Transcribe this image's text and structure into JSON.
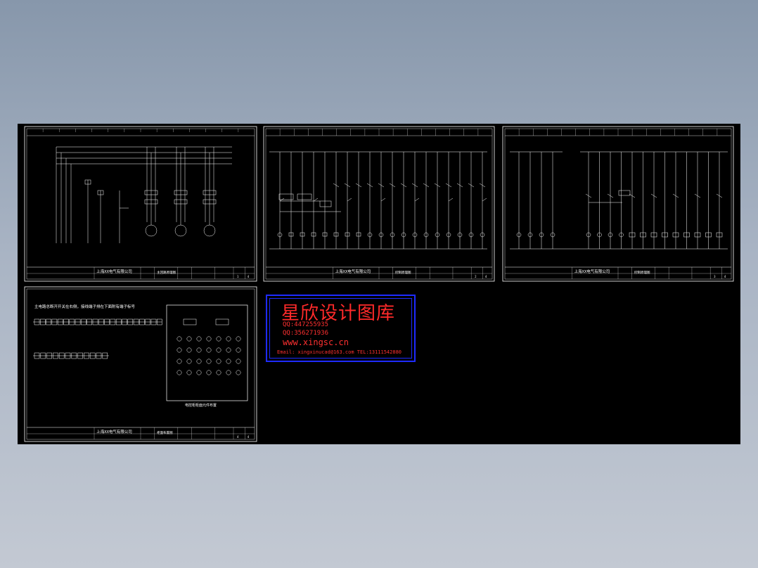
{
  "sheets": [
    {
      "company": "上海XX电气有限公司",
      "drawing": "主回路原理图",
      "sheet_no": "1",
      "total": "4"
    },
    {
      "company": "上海XX电气有限公司",
      "drawing": "控制原理图",
      "sheet_no": "2",
      "total": "4"
    },
    {
      "company": "上海XX电气有限公司",
      "drawing": "控制原理图",
      "sheet_no": "3",
      "total": "4"
    },
    {
      "company": "上海XX电气有限公司",
      "drawing": "柜面布置图",
      "sheet_no": "4",
      "total": "4"
    }
  ],
  "sheet4": {
    "note": "主电路总断开开关在右侧，接线端子排在下面附有端子标号"
  },
  "panel": {
    "caption": "电控柜柜面元件布置"
  },
  "stamp": {
    "title": "星欣设计图库",
    "qq1": "QQ:447255935",
    "qq2": "QQ:356271936",
    "url": "www.xingsc.cn",
    "email": "Email: xingxinucad@163.com  TEL:13111542880"
  },
  "colors": {
    "background": "#000000",
    "lines": "#ffffff",
    "stamp_text": "#ff2a2a",
    "stamp_border": "#1e2bff"
  }
}
